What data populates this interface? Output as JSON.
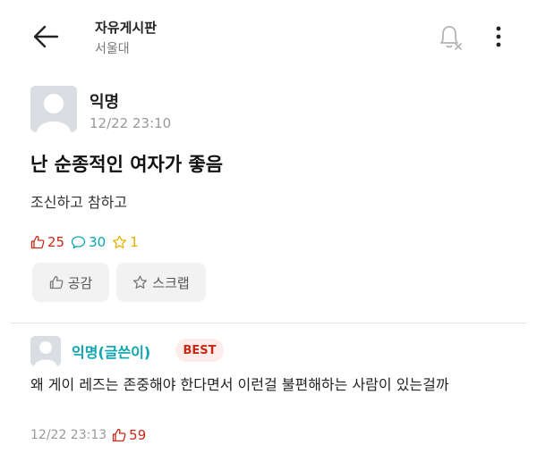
{
  "header": {
    "title": "자유게시판",
    "subtitle": "서울대"
  },
  "post": {
    "author": "익명",
    "date": "12/22 23:10",
    "title": "난 순종적인 여자가 좋음",
    "body": "조신하고 참하고",
    "likes": "25",
    "comments": "30",
    "scraps": "1",
    "like_button": "공감",
    "scrap_button": "스크랩"
  },
  "comment": {
    "author": "익명(글쓴이)",
    "badge": "BEST",
    "body": "왜 게이 레즈는 존중해야 한다면서 이런걸 불편해하는 사람이 있는걸까",
    "date": "12/22 23:13",
    "likes": "59"
  },
  "colors": {
    "accent_teal": "#0ca5b0",
    "like_red": "#c62917",
    "scrap_yellow": "#e6b200",
    "avatar_gray": "#dadde1"
  },
  "icons": [
    "back-arrow-icon",
    "notification-off-icon",
    "more-vertical-icon",
    "thumbs-up-icon",
    "comment-bubble-icon",
    "star-icon",
    "avatar-icon"
  ]
}
